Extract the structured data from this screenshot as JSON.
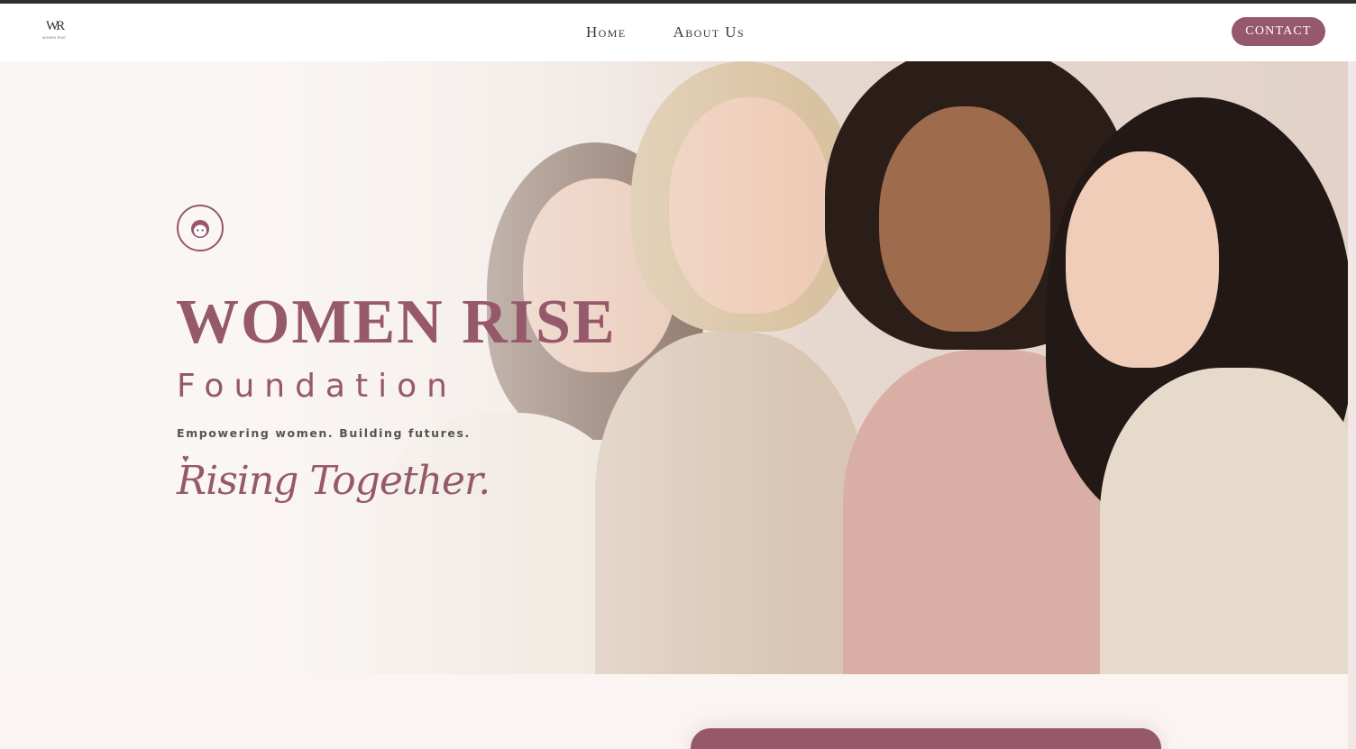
{
  "brand": {
    "logo_mark": "WR",
    "logo_sub": "WOMEN RISE"
  },
  "nav": {
    "items": [
      {
        "label": "Home"
      },
      {
        "label": "About Us"
      }
    ],
    "contact_label": "CONTACT"
  },
  "hero": {
    "icon": "woman-face-icon",
    "title": "WOMEN RISE",
    "subtitle": "Foundation",
    "tagline": "Empowering women. Building futures.",
    "script": "Rising Together.",
    "accent_icon": "heart-icon"
  },
  "colors": {
    "accent": "#96596c",
    "background": "#faf5f3",
    "header": "#ffffff",
    "text": "#3a3a3a"
  }
}
